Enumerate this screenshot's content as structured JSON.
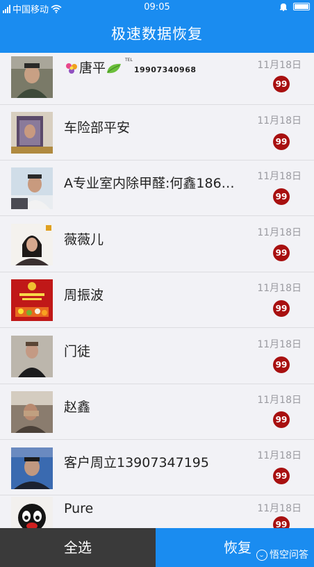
{
  "status_bar": {
    "carrier": "中国移动",
    "time": "09:05"
  },
  "header": {
    "title": "极速数据恢复"
  },
  "contacts": [
    {
      "name": "唐平",
      "extra_tel_label": "TEL",
      "extra_tel": "19907340968",
      "date": "11月18日",
      "badge": "99"
    },
    {
      "name": "车险部平安",
      "date": "11月18日",
      "badge": "99"
    },
    {
      "name": "A专业室内除甲醛:何鑫186…",
      "date": "11月18日",
      "badge": "99"
    },
    {
      "name": "薇薇儿",
      "date": "11月18日",
      "badge": "99"
    },
    {
      "name": "周振波",
      "date": "11月18日",
      "badge": "99"
    },
    {
      "name": "门徒",
      "date": "11月18日",
      "badge": "99"
    },
    {
      "name": "赵鑫",
      "date": "11月18日",
      "badge": "99"
    },
    {
      "name": "客户周立13907347195",
      "date": "11月18日",
      "badge": "99"
    },
    {
      "name": "Pure",
      "date": "11月18日",
      "badge": "99"
    }
  ],
  "bottom_bar": {
    "select_all_label": "全选",
    "restore_label": "恢复",
    "watermark": "悟空问答"
  },
  "colors": {
    "primary": "#1a8cf0",
    "dark_button": "#3a3a3a",
    "badge": "#a81010"
  }
}
